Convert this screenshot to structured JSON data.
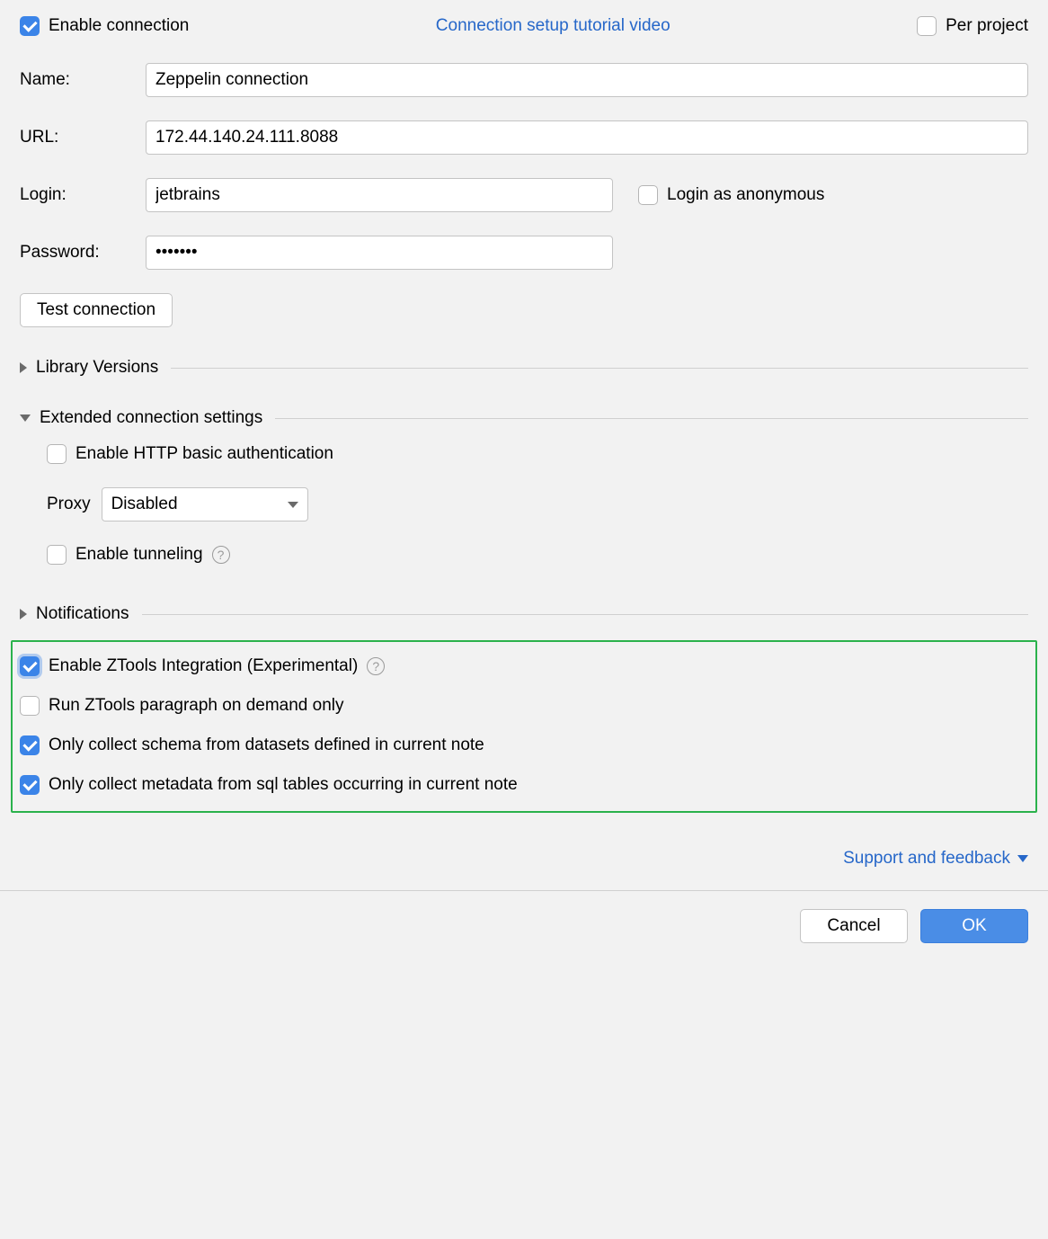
{
  "top": {
    "enable_connection_label": "Enable connection",
    "tutorial_link": "Connection setup tutorial video",
    "per_project_label": "Per project"
  },
  "form": {
    "name_label": "Name:",
    "name_value": "Zeppelin connection",
    "url_label": "URL:",
    "url_value": "172.44.140.24.111.8088",
    "login_label": "Login:",
    "login_value": "jetbrains",
    "anonymous_label": "Login as anonymous",
    "password_label": "Password:",
    "password_value": "•••••••",
    "test_button": "Test connection"
  },
  "sections": {
    "library_versions": "Library Versions",
    "extended_settings": "Extended connection settings",
    "notifications": "Notifications"
  },
  "extended": {
    "http_basic_label": "Enable HTTP basic authentication",
    "proxy_label": "Proxy",
    "proxy_value": "Disabled",
    "tunneling_label": "Enable tunneling"
  },
  "ztools": {
    "enable_label": "Enable ZTools Integration (Experimental)",
    "on_demand_label": "Run ZTools paragraph on demand only",
    "schema_label": "Only collect schema from datasets defined in current note",
    "metadata_label": "Only collect metadata from sql tables occurring in current note"
  },
  "footer": {
    "support_link": "Support and feedback",
    "cancel": "Cancel",
    "ok": "OK"
  }
}
